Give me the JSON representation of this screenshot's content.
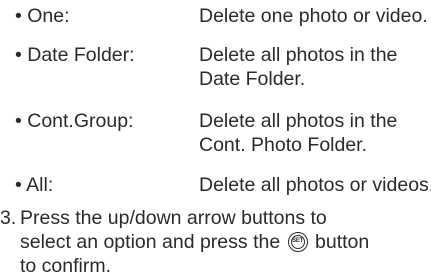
{
  "options": [
    {
      "term": "• One:",
      "description_lines": [
        "Delete one photo or video."
      ]
    },
    {
      "term": "• Date Folder:",
      "description_lines": [
        "Delete all photos in the",
        "Date Folder."
      ]
    },
    {
      "term": "• Cont.Group:",
      "description_lines": [
        "Delete all photos in the",
        "Cont. Photo Folder."
      ]
    },
    {
      "term": "• All:",
      "description_lines": [
        "Delete all photos or videos."
      ]
    }
  ],
  "step": {
    "number": "3.",
    "line1": "Press the up/down arrow buttons to",
    "line2_before": "select an option and press the",
    "line2_after": "button",
    "line3": "to confirm.",
    "icon_label": "SET",
    "icon_name": "set-button-icon"
  }
}
